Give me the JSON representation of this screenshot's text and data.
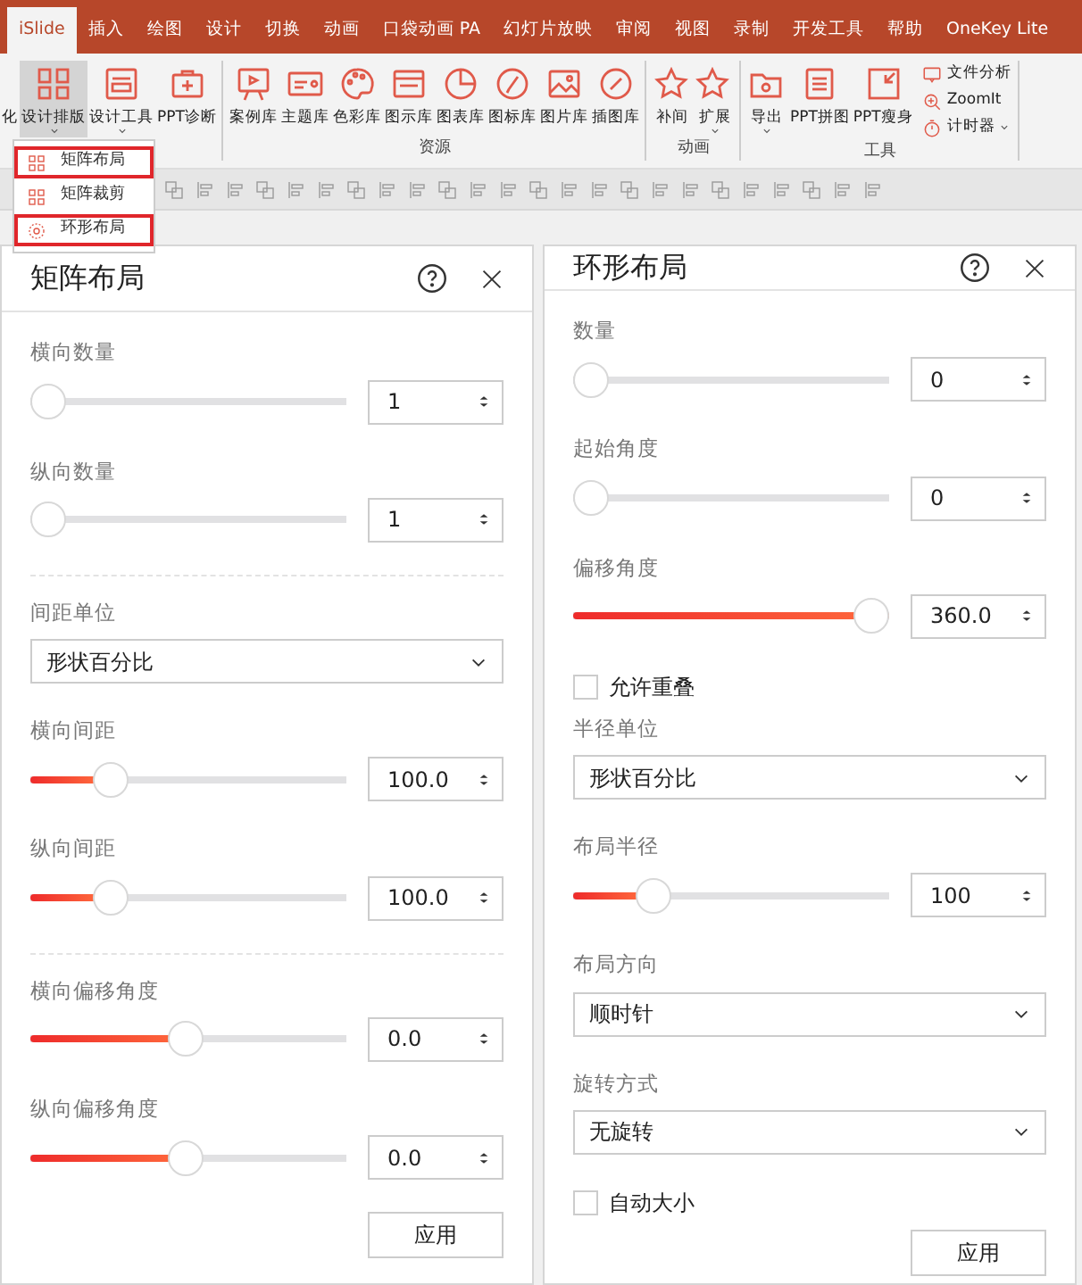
{
  "ribbon_tabs": [
    {
      "label": "iSlide",
      "selected": true
    },
    {
      "label": "插入",
      "selected": false
    },
    {
      "label": "绘图",
      "selected": false
    },
    {
      "label": "设计",
      "selected": false
    },
    {
      "label": "切换",
      "selected": false
    },
    {
      "label": "动画",
      "selected": false
    },
    {
      "label": "口袋动画 PA",
      "selected": false
    },
    {
      "label": "幻灯片放映",
      "selected": false
    },
    {
      "label": "审阅",
      "selected": false
    },
    {
      "label": "视图",
      "selected": false
    },
    {
      "label": "录制",
      "selected": false
    },
    {
      "label": "开发工具",
      "selected": false
    },
    {
      "label": "帮助",
      "selected": false
    },
    {
      "label": "OneKey Lite",
      "selected": false
    }
  ],
  "ribbon_groups": [
    {
      "buttons": [
        {
          "label": "化",
          "selected": false,
          "caret": false
        },
        {
          "label": "设计排版",
          "selected": true,
          "caret": true
        },
        {
          "label": "设计工具",
          "selected": false,
          "caret": true
        },
        {
          "label": "PPT诊断",
          "selected": false,
          "caret": false
        }
      ]
    },
    {
      "label": "资源",
      "buttons": [
        {
          "label": "案例库",
          "selected": false,
          "caret": false
        },
        {
          "label": "主题库",
          "selected": false,
          "caret": false
        },
        {
          "label": "色彩库",
          "selected": false,
          "caret": false
        },
        {
          "label": "图示库",
          "selected": false,
          "caret": false
        },
        {
          "label": "图表库",
          "selected": false,
          "caret": false
        },
        {
          "label": "图标库",
          "selected": false,
          "caret": false
        },
        {
          "label": "图片库",
          "selected": false,
          "caret": false
        },
        {
          "label": "插图库",
          "selected": false,
          "caret": false
        }
      ]
    },
    {
      "label": "动画",
      "buttons": [
        {
          "label": "补间",
          "selected": false,
          "caret": false
        },
        {
          "label": "扩展",
          "selected": false,
          "caret": true
        }
      ]
    },
    {
      "label": "工具",
      "buttons": [
        {
          "label": "导出",
          "selected": false,
          "caret": true
        },
        {
          "label": "PPT拼图",
          "selected": false,
          "caret": false
        },
        {
          "label": "PPT瘦身",
          "selected": false,
          "caret": false
        }
      ],
      "small_buttons": [
        {
          "label": "文件分析",
          "caret": false
        },
        {
          "label": "ZoomIt",
          "caret": false
        },
        {
          "label": "计时器",
          "caret": true
        }
      ]
    }
  ],
  "dropdown_menu": [
    {
      "label": "矩阵布局",
      "outlined": true
    },
    {
      "label": "矩阵裁剪",
      "outlined": false
    },
    {
      "label": "环形布局",
      "outlined": true
    }
  ],
  "panels": [
    {
      "title": "矩阵布局",
      "controls": [
        {
          "kind": "slider",
          "label": "横向数量",
          "value": "1",
          "level": 0
        },
        {
          "kind": "slider",
          "label": "纵向数量",
          "value": "1",
          "level": 0
        },
        {
          "kind": "divider"
        },
        {
          "kind": "select",
          "label": "间距单位",
          "value": "形状百分比"
        },
        {
          "kind": "slider",
          "label": "横向间距",
          "value": "100.0",
          "level": 0.22
        },
        {
          "kind": "slider",
          "label": "纵向间距",
          "value": "100.0",
          "level": 0.22
        },
        {
          "kind": "divider"
        },
        {
          "kind": "slider",
          "label": "横向偏移角度",
          "value": "0.0",
          "level": 0.49
        },
        {
          "kind": "slider",
          "label": "纵向偏移角度",
          "value": "0.0",
          "level": 0.49
        }
      ],
      "apply_button": "应用"
    },
    {
      "title": "环形布局",
      "controls": [
        {
          "kind": "slider",
          "label": "数量",
          "value": "0",
          "level": 0
        },
        {
          "kind": "slider",
          "label": "起始角度",
          "value": "0",
          "level": 0
        },
        {
          "kind": "slider",
          "label": "偏移角度",
          "value": "360.0",
          "level": 1
        },
        {
          "kind": "checkbox",
          "label": "允许重叠",
          "checked": false
        },
        {
          "kind": "select",
          "label": "半径单位",
          "value": "形状百分比"
        },
        {
          "kind": "slider",
          "label": "布局半径",
          "value": "100",
          "level": 0.22
        },
        {
          "kind": "select",
          "label": "布局方向",
          "value": "顺时针"
        },
        {
          "kind": "select",
          "label": "旋转方式",
          "value": "无旋转"
        },
        {
          "kind": "checkbox",
          "label": "自动大小",
          "checked": false
        }
      ],
      "apply_button": "应用"
    }
  ]
}
